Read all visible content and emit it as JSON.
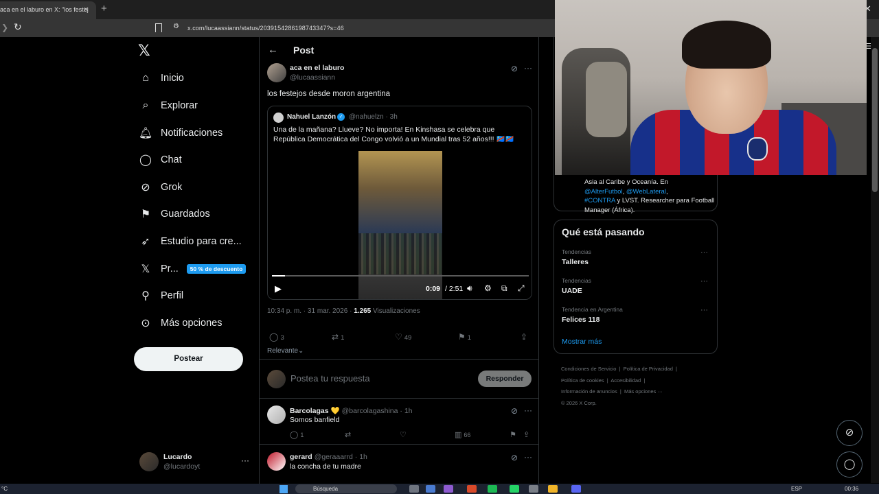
{
  "browser": {
    "tab_title": "aca en el laburo en X: \"los festej",
    "tab_close": "×",
    "new_tab": "+",
    "url": "x.com/lucaassiann/status/2039154286198743347?s=46"
  },
  "nav": {
    "items": [
      {
        "label": "Inicio",
        "icon": "home-icon"
      },
      {
        "label": "Explorar",
        "icon": "search-icon"
      },
      {
        "label": "Notificaciones",
        "icon": "bell-icon"
      },
      {
        "label": "Chat",
        "icon": "chat-icon"
      },
      {
        "label": "Grok",
        "icon": "grok-icon"
      },
      {
        "label": "Guardados",
        "icon": "bookmark-icon"
      },
      {
        "label": "Estudio para cre...",
        "icon": "rocket-icon"
      },
      {
        "label": "Pr...",
        "icon": "x-icon",
        "badge": "50 % de descuento"
      },
      {
        "label": "Perfil",
        "icon": "person-icon"
      },
      {
        "label": "Más opciones",
        "icon": "more-circle-icon"
      }
    ],
    "post_button": "Postear",
    "account": {
      "name": "Lucardo",
      "handle": "@lucardoyt"
    }
  },
  "post": {
    "header_title": "Post",
    "author_name": "aca en el laburo",
    "author_handle": "@lucaassiann",
    "text": "los festejos desde moron argentina",
    "quote": {
      "name": "Nahuel Lanzón",
      "handle": "@nahuelzn · 3h",
      "text": "Una de la mañana? Llueve? No importa! En Kinshasa se celebra que República Democrática del Congo volvió a un Mundial tras 52 años!!! 🇨🇩🇨🇩",
      "video": {
        "current": "0:09",
        "duration": "/ 2:51",
        "progress": 0.05
      }
    },
    "meta": {
      "time": "10:34 p. m. · 31 mar. 2026 · ",
      "views": "1.265",
      "views_label": " Visualizaciones"
    },
    "actions": {
      "replies": "3",
      "reposts": "1",
      "likes": "49",
      "bookmarks": "1"
    },
    "sort_label": "Relevante⌄",
    "reply_placeholder": "Postea tu respuesta",
    "reply_button": "Responder"
  },
  "replies": [
    {
      "name": "Barcolagas 💛",
      "handle": "@barcolagashina · 1h",
      "text": "Somos banfield",
      "replies": "1",
      "views": "66"
    },
    {
      "name": "gerard",
      "handle": "@geraaarrd · 1h",
      "text": "la concha de tu madre",
      "replies": "",
      "views": ""
    }
  ],
  "sidebar": {
    "bio_line1": "Asia al Caribe y Oceanía. En",
    "bio_link1": "@AlterFutbol",
    "bio_sep": ", ",
    "bio_link2": "@WebLateral",
    "bio_comma": ",",
    "bio_link3": "#CONTRA",
    "bio_line3": " y LVST. Researcher para Football Manager (África).",
    "trends_title": "Qué está pasando",
    "trends": [
      {
        "context": "Tendencias",
        "name": "Talleres"
      },
      {
        "context": "Tendencias",
        "name": "UADE"
      },
      {
        "context": "Tendencia en Argentina",
        "name": "Felices 118"
      }
    ],
    "show_more": "Mostrar más",
    "footer": [
      "Condiciones de Servicio",
      "Política de Privacidad",
      "Política de cookies",
      "Accesibilidad",
      "Información de anuncios",
      "Más opciones ···",
      "© 2026 X Corp."
    ]
  },
  "taskbar": {
    "temp": "°C",
    "search": "Búsqueda",
    "lang": "ESP",
    "time": "00:36"
  }
}
